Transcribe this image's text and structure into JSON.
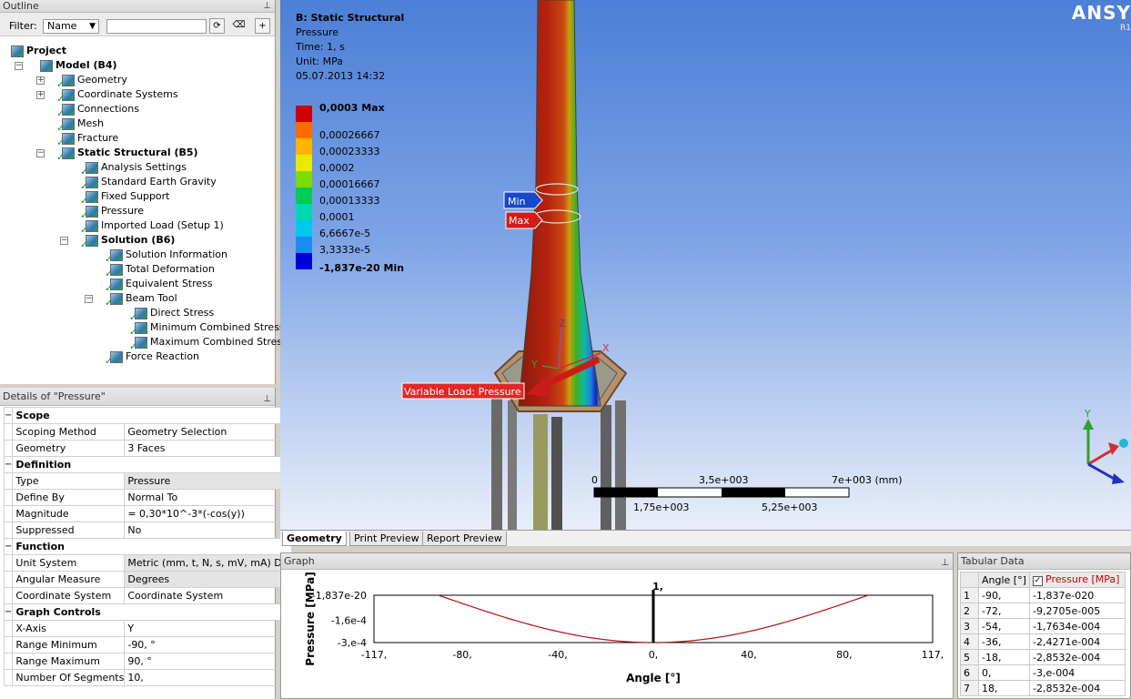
{
  "outline": {
    "title": "Outline",
    "filter_label": "Filter:",
    "filter_value": "Name",
    "tree": [
      {
        "label": "Project",
        "bold": true
      },
      {
        "label": "Model (B4)",
        "bold": true
      },
      {
        "label": "Geometry"
      },
      {
        "label": "Coordinate Systems"
      },
      {
        "label": "Connections"
      },
      {
        "label": "Mesh"
      },
      {
        "label": "Fracture"
      },
      {
        "label": "Static Structural (B5)",
        "bold": true
      },
      {
        "label": "Analysis Settings"
      },
      {
        "label": "Standard Earth Gravity"
      },
      {
        "label": "Fixed Support"
      },
      {
        "label": "Pressure"
      },
      {
        "label": "Imported Load (Setup 1)"
      },
      {
        "label": "Solution (B6)",
        "bold": true
      },
      {
        "label": "Solution Information"
      },
      {
        "label": "Total Deformation"
      },
      {
        "label": "Equivalent Stress"
      },
      {
        "label": "Beam Tool"
      },
      {
        "label": "Direct Stress"
      },
      {
        "label": "Minimum Combined Stress"
      },
      {
        "label": "Maximum Combined Stress"
      },
      {
        "label": "Force Reaction"
      }
    ]
  },
  "details": {
    "title": "Details of \"Pressure\"",
    "rows": [
      {
        "group": "Scope"
      },
      {
        "k": "Scoping Method",
        "v": "Geometry Selection"
      },
      {
        "k": "Geometry",
        "v": "3 Faces"
      },
      {
        "group": "Definition"
      },
      {
        "k": "Type",
        "v": "Pressure",
        "shade": true
      },
      {
        "k": "Define By",
        "v": "Normal To"
      },
      {
        "k": "Magnitude",
        "v": "= 0,30*10^-3*(-cos(y))"
      },
      {
        "k": "Suppressed",
        "v": "No"
      },
      {
        "group": "Function"
      },
      {
        "k": "Unit System",
        "v": "Metric (mm, t, N, s, mV, mA)  D...",
        "shade": true
      },
      {
        "k": "Angular Measure",
        "v": "Degrees",
        "shade": true
      },
      {
        "k": "Coordinate System",
        "v": "Coordinate System"
      },
      {
        "group": "Graph Controls"
      },
      {
        "k": "X-Axis",
        "v": "Y"
      },
      {
        "k": "Range Minimum",
        "v": "-90, °"
      },
      {
        "k": "Range Maximum",
        "v": "90, °"
      },
      {
        "k": "Number Of Segments",
        "v": "10,"
      }
    ]
  },
  "viewport": {
    "title": "B: Static Structural",
    "lines": [
      "Pressure",
      "Time: 1, s",
      "Unit: MPa",
      "05.07.2013 14:32"
    ],
    "brand": "ANSY",
    "brand_sub": "R1",
    "legend": [
      {
        "label": "0,0003 Max",
        "color": "#cc0000",
        "bold": true
      },
      {
        "label": "0,00026667",
        "color": "#ff6a00"
      },
      {
        "label": "0,00023333",
        "color": "#ffb400"
      },
      {
        "label": "0,0002",
        "color": "#e8e800"
      },
      {
        "label": "0,00016667",
        "color": "#7cdc00"
      },
      {
        "label": "0,00013333",
        "color": "#00cc55"
      },
      {
        "label": "0,0001",
        "color": "#00d8b0"
      },
      {
        "label": "6,6667e-5",
        "color": "#00c8f0"
      },
      {
        "label": "3,3333e-5",
        "color": "#1c8cf0"
      },
      {
        "label": "-1,837e-20 Min",
        "color": "#0000d8",
        "bold": true
      }
    ],
    "min_tag": "Min",
    "max_tag": "Max",
    "load_tag": "Variable Load: Pressure",
    "scale": {
      "top": [
        "0",
        "3,5e+003",
        "7e+003 (mm)"
      ],
      "bottom": [
        "1,75e+003",
        "5,25e+003"
      ]
    },
    "axis_labels": {
      "z": "Z",
      "x": "X",
      "y": "Y"
    },
    "triad": {
      "y": "Y"
    }
  },
  "tabs": [
    "Geometry",
    "Print Preview",
    "Report Preview"
  ],
  "graph": {
    "title": "Graph",
    "chart_data": {
      "type": "line",
      "xlabel": "Angle [°]",
      "ylabel": "Pressure [MPa]",
      "xticks": [
        "-117,",
        "-80,",
        "-40,",
        "0,",
        "40,",
        "80,",
        "117,"
      ],
      "yticks": [
        "-1,837e-20",
        "-1,6e-4",
        "-3,e-4"
      ],
      "xlim": [
        -117,
        117
      ],
      "ylim": [
        -0.0003,
        0
      ],
      "marker_label": "1,",
      "x": [
        -90,
        -72,
        -54,
        -36,
        -18,
        0,
        18,
        36,
        54,
        72,
        90
      ],
      "y": [
        0,
        -9.2705e-05,
        -0.00017634,
        -0.00024271,
        -0.00028532,
        -0.0003,
        -0.00028532,
        -0.00024271,
        -0.00017634,
        -9.2705e-05,
        0
      ]
    }
  },
  "tabular": {
    "title": "Tabular Data",
    "headers": [
      "Angle [°]",
      "Pressure [MPa]"
    ],
    "rows": [
      [
        "1",
        "-90,",
        "-1,837e-020"
      ],
      [
        "2",
        "-72,",
        "-9,2705e-005"
      ],
      [
        "3",
        "-54,",
        "-1,7634e-004"
      ],
      [
        "4",
        "-36,",
        "-2,4271e-004"
      ],
      [
        "5",
        "-18,",
        "-2,8532e-004"
      ],
      [
        "6",
        "0,",
        "-3,e-004"
      ],
      [
        "7",
        "18,",
        "-2,8532e-004"
      ]
    ]
  }
}
